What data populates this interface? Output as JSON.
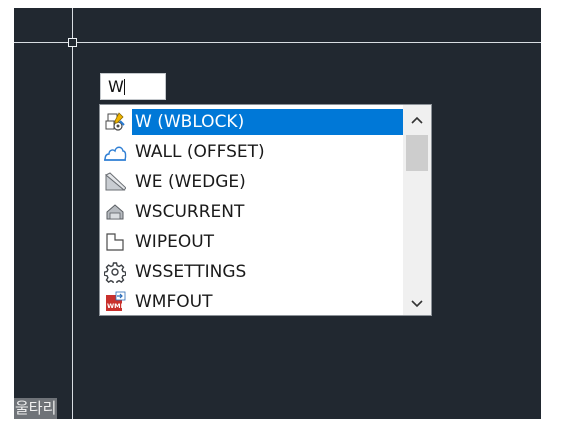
{
  "command_input": {
    "value": "W"
  },
  "autocomplete": {
    "items": [
      {
        "label": "W (WBLOCK)",
        "icon": "wblock-icon",
        "selected": true
      },
      {
        "label": "WALL (OFFSET)",
        "icon": "wall-cloud-icon",
        "selected": false
      },
      {
        "label": "WE (WEDGE)",
        "icon": "wedge-icon",
        "selected": false
      },
      {
        "label": "WSCURRENT",
        "icon": "workspace-house-icon",
        "selected": false
      },
      {
        "label": "WIPEOUT",
        "icon": "wipeout-icon",
        "selected": false
      },
      {
        "label": "WSSETTINGS",
        "icon": "gear-icon",
        "selected": false
      },
      {
        "label": "WMFOUT",
        "icon": "wmf-export-icon",
        "selected": false
      }
    ]
  },
  "ime_indicator": {
    "text": "울타리"
  },
  "colors": {
    "canvas": "#212830",
    "selection": "#0078d7",
    "crosshair": "#d8dde2"
  }
}
